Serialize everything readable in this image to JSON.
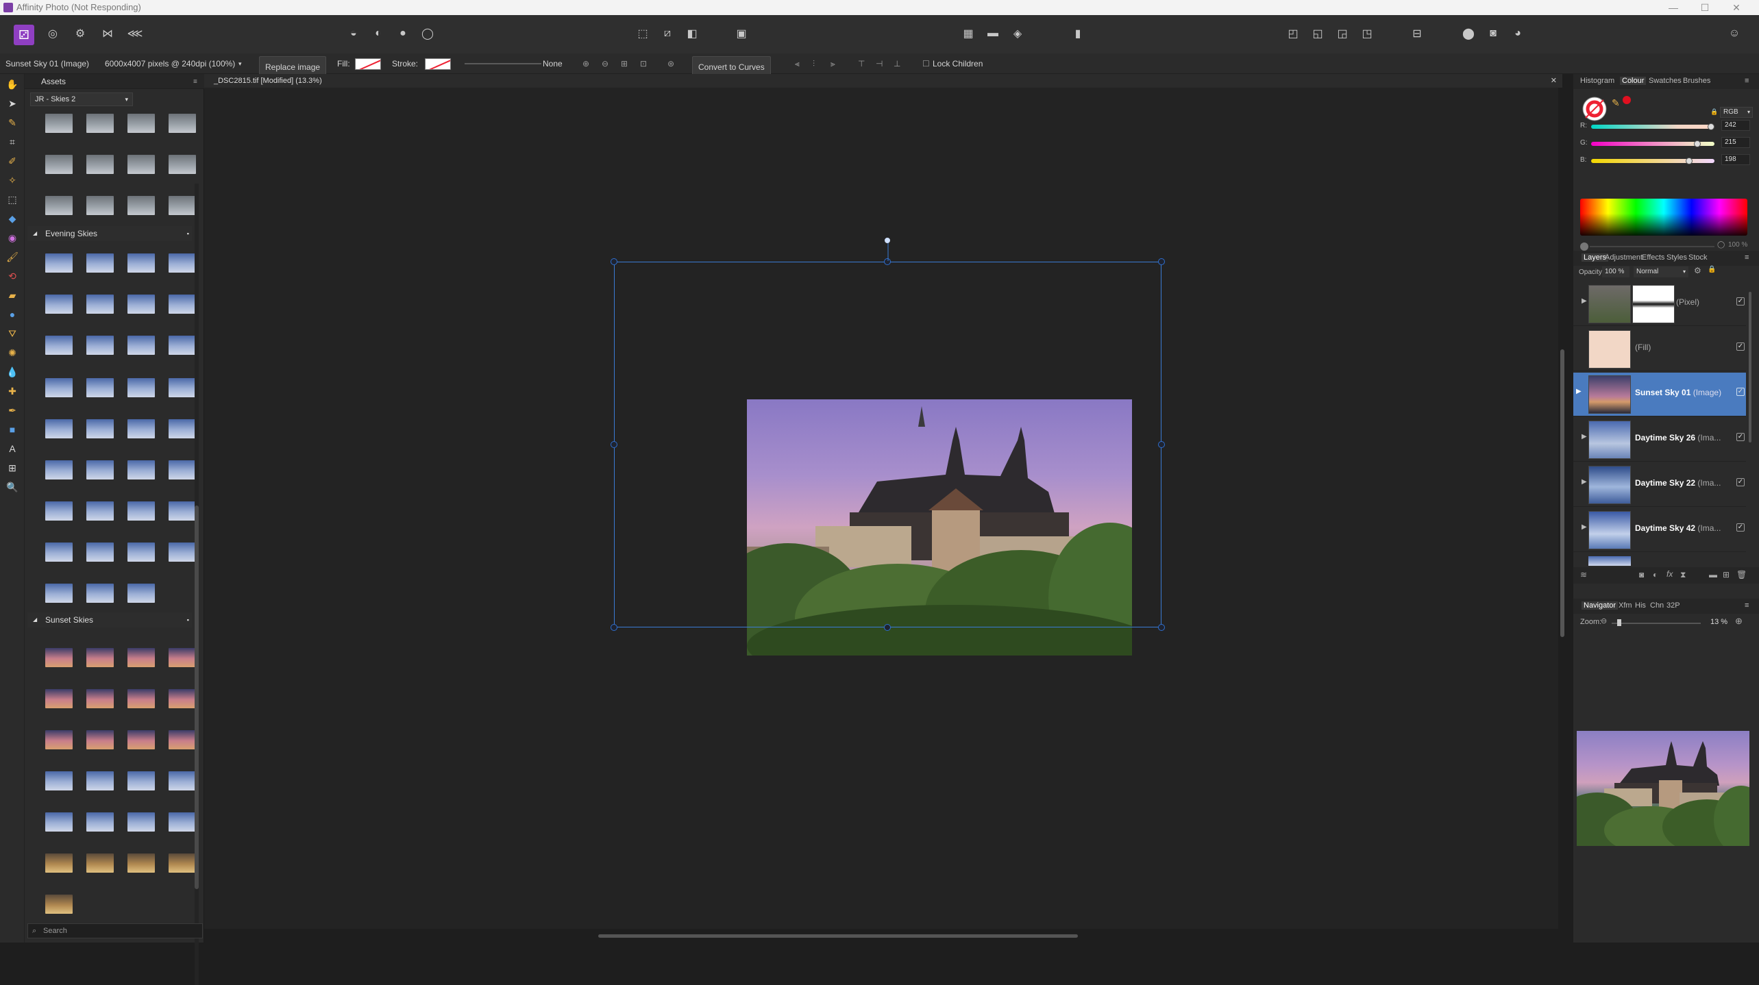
{
  "app": {
    "title": "Affinity Photo (Not Responding)"
  },
  "context_bar": {
    "layer_name": "Sunset Sky 01 (Image)",
    "layer_info": "6000x4007 pixels @ 240dpi (100%)",
    "replace_image": "Replace image",
    "fill_label": "Fill:",
    "stroke_label": "Stroke:",
    "stroke_style": "None",
    "convert_to_curves": "Convert to Curves",
    "lock_children": "Lock Children"
  },
  "assets_panel": {
    "tab_label": "Assets",
    "category": "JR - Skies 2",
    "sections": [
      {
        "name": "Evening Skies"
      },
      {
        "name": "Sunset Skies"
      }
    ],
    "search_placeholder": "Search"
  },
  "document": {
    "tab_title": "_DSC2815.tif [Modified] (13.3%)"
  },
  "right_panel": {
    "colour_tabs": [
      "Histogram",
      "Colour",
      "Swatches",
      "Brushes"
    ],
    "colour_tab_active": "Colour",
    "colour_model": "RGB",
    "r_label": "R:",
    "g_label": "G:",
    "b_label": "B:",
    "r_value": "242",
    "g_value": "215",
    "b_value": "198",
    "opacity_readout": "100 %",
    "current_color": "#f2d7c6",
    "layer_tabs": [
      "Layers",
      "Adjustment",
      "Effects",
      "Styles",
      "Stock"
    ],
    "layer_tab_active": "Layers",
    "opacity_label": "Opacity:",
    "opacity_value": "100 %",
    "blend_mode": "Normal",
    "layers": [
      {
        "name": "",
        "type": "(Pixel)",
        "selected": false
      },
      {
        "name": "",
        "type": "(Fill)",
        "selected": false
      },
      {
        "name": "Sunset Sky 01",
        "type": "(Image)",
        "selected": true
      },
      {
        "name": "Daytime Sky 26",
        "type": "(Ima...",
        "selected": false
      },
      {
        "name": "Daytime Sky 22",
        "type": "(Ima...",
        "selected": false
      },
      {
        "name": "Daytime Sky 42",
        "type": "(Ima...",
        "selected": false
      }
    ],
    "nav_tabs": [
      "Navigator",
      "Xfm",
      "His",
      "Chn",
      "32P"
    ],
    "nav_tab_active": "Navigator",
    "zoom_label": "Zoom:",
    "zoom_value": "13 %"
  },
  "colors": {
    "accent": "#8f3fc2",
    "selection": "#3a7bd5",
    "layer_selected": "#4a7bbf"
  }
}
